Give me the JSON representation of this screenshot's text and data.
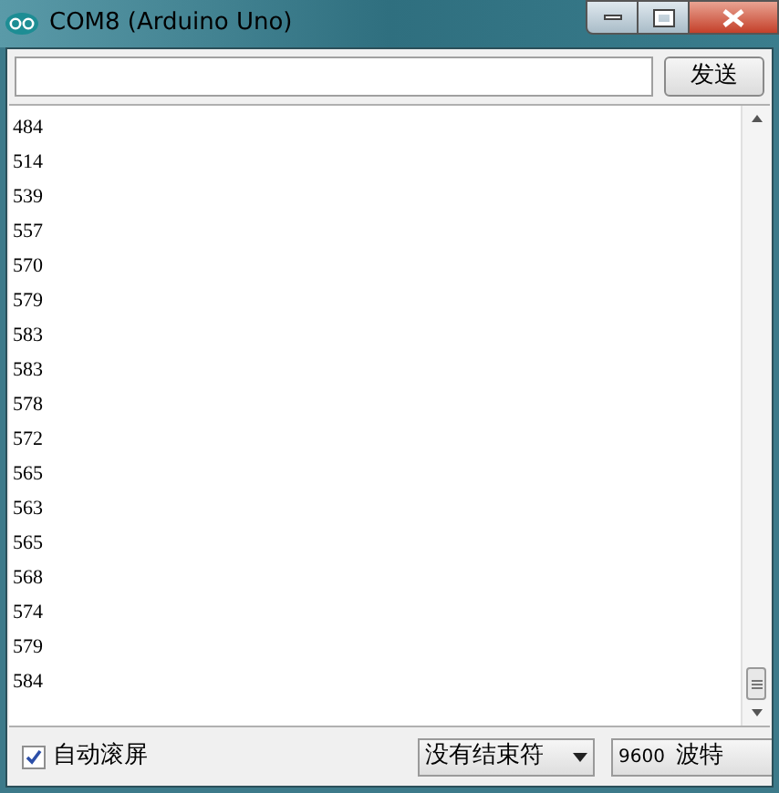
{
  "window": {
    "title": "COM8 (Arduino Uno)"
  },
  "send_button": "发送",
  "output_lines": [
    "484",
    "514",
    "539",
    "557",
    "570",
    "579",
    "583",
    "583",
    "578",
    "572",
    "565",
    "563",
    "565",
    "568",
    "574",
    "579",
    "584"
  ],
  "autoscroll": {
    "label": "自动滚屏",
    "checked": true
  },
  "line_ending": "没有结束符",
  "baud": {
    "value": "9600",
    "unit": "波特"
  }
}
